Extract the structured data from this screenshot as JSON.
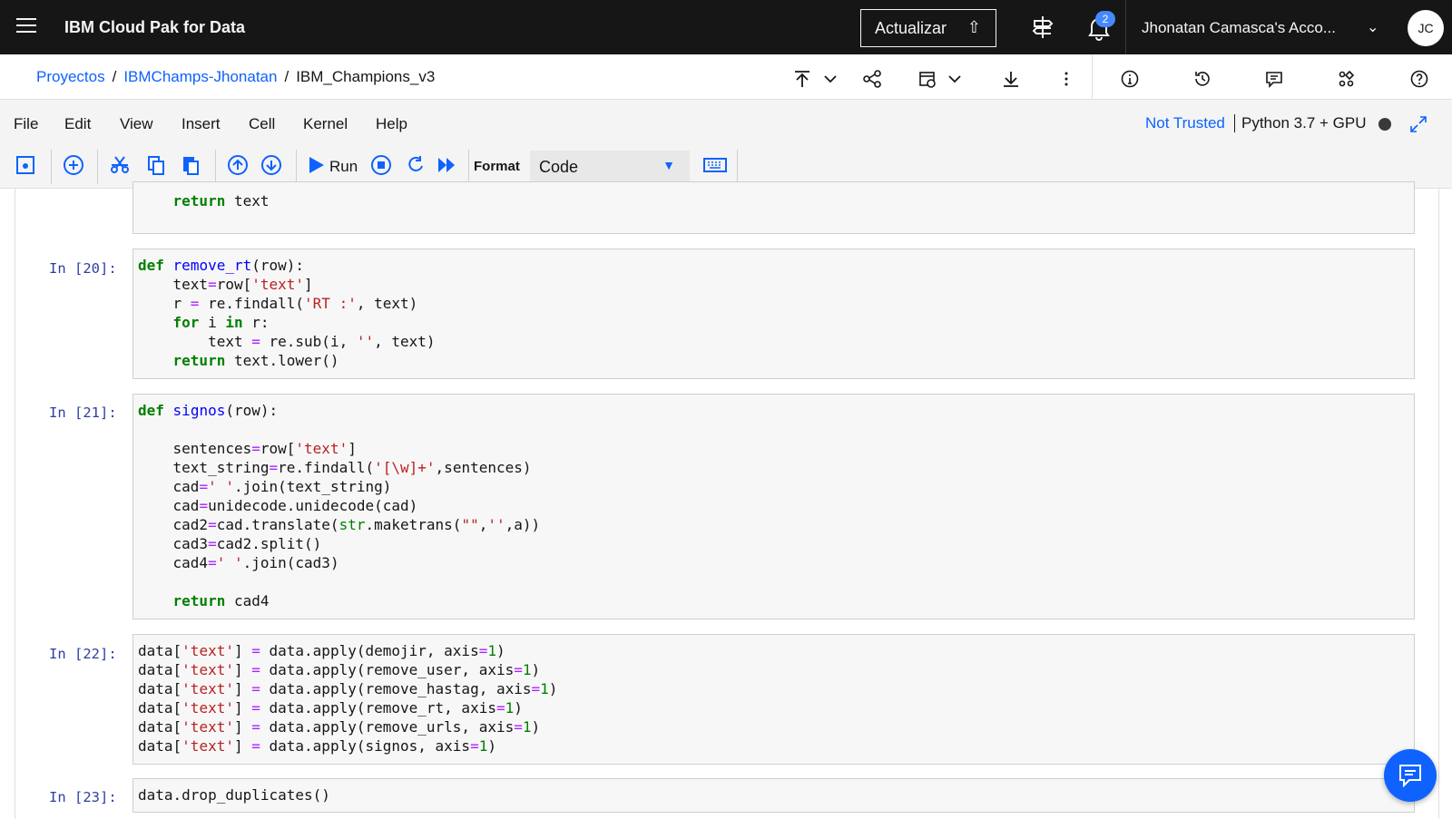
{
  "header": {
    "brand": "IBM Cloud Pak for Data",
    "upgrade_label": "Actualizar",
    "notification_count": "2",
    "account_name": "Jhonatan Camasca's Acco...",
    "avatar_initials": "JC"
  },
  "breadcrumb": {
    "items": [
      "Proyectos",
      "IBMChamps-Jhonatan"
    ],
    "current": "IBM_Champions_v3"
  },
  "menu": {
    "items": [
      "File",
      "Edit",
      "View",
      "Insert",
      "Cell",
      "Kernel",
      "Help"
    ],
    "trust_status": "Not Trusted",
    "kernel_name": "Python 3.7 + GPU"
  },
  "toolbar": {
    "run_label": "Run",
    "format_label": "Format",
    "format_value": "Code"
  },
  "cells": [
    {
      "prompt": "",
      "lines": [
        "    return text"
      ]
    },
    {
      "prompt": "In [20]:"
    },
    {
      "prompt": "In [21]:"
    },
    {
      "prompt": "In [22]:"
    },
    {
      "prompt": "In [23]:"
    }
  ],
  "colors": {
    "header_bg": "#161616",
    "accent": "#0f62fe",
    "prompt": "#303f9f",
    "keyword": "#008000",
    "string": "#ba2121"
  }
}
